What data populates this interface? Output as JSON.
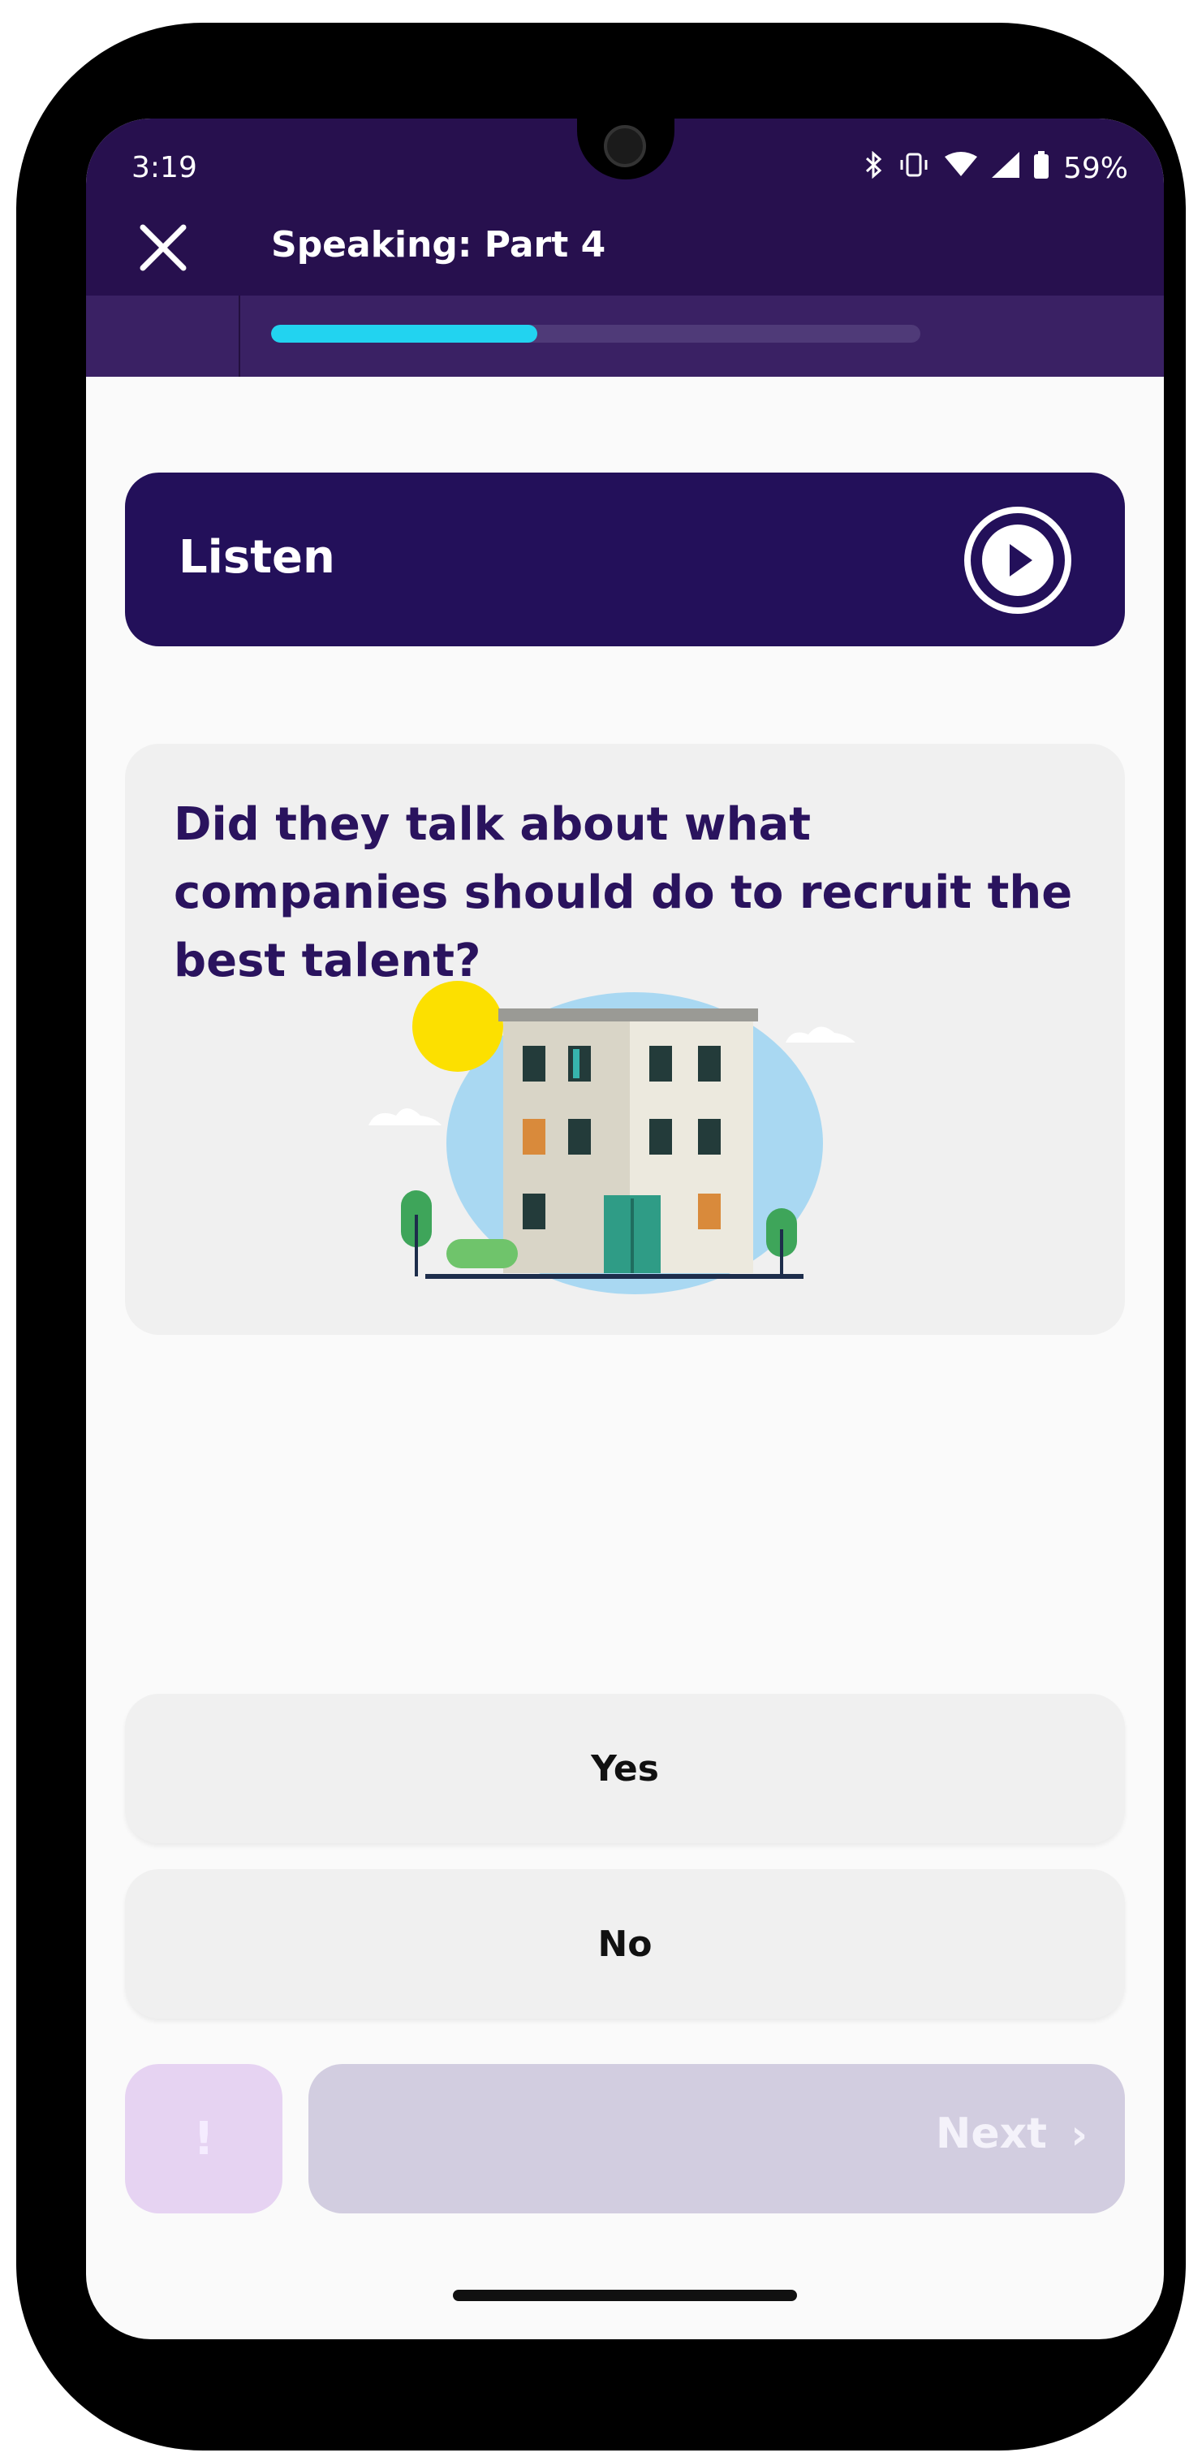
{
  "status_bar": {
    "time": "3:19",
    "battery": "59%",
    "icons": [
      "bluetooth-icon",
      "vibrate-icon",
      "wifi-icon",
      "signal-icon",
      "battery-icon"
    ]
  },
  "header": {
    "title": "Speaking: Part 4",
    "close_icon": "close-icon",
    "progress": 0.41
  },
  "listen": {
    "label": "Listen",
    "icon": "play-icon"
  },
  "question": {
    "text": "Did they talk about what companies should do to recruit the best talent?"
  },
  "answers": [
    {
      "label": "Yes"
    },
    {
      "label": "No"
    }
  ],
  "footer": {
    "report_label": "!",
    "next_label": "Next",
    "next_chevron": "›"
  },
  "colors": {
    "header": "#27104e",
    "accent_progress": "#22d3f0",
    "listen_bar": "#23105a",
    "question_text": "#2a135e",
    "disabled_next": "#d2cde0",
    "report_button": "#e6d3f2"
  }
}
